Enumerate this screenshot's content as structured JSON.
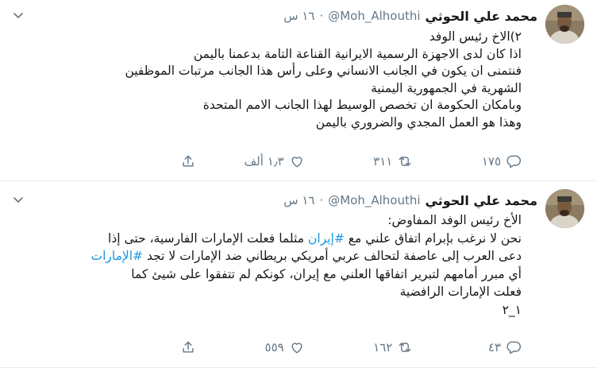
{
  "tweets": [
    {
      "name": "محمد علي الحوثي",
      "handle": "@Moh_Alhouthi",
      "separator": "·",
      "time": "١٦ س",
      "lines": [
        "٢)الاخ رئيس الوفد",
        "اذا كان لدى الاجهزة الرسمية الايرانية القناعة التامة بدعمنا باليمن",
        "فنتمنى ان يكون في الجانب الانساني وعلى رأس هذا الجانب مرتبات الموظفين",
        "الشهرية في الجمهورية اليمنية",
        "وبامكان الحكومة ان تخصص الوسيط لهذا الجانب الامم المتحدة",
        "وهذا هو العمل المجدي والضروري باليمن"
      ],
      "replies": "١٧٥",
      "retweets": "٣١١",
      "likes": "١٫٣ ألف"
    },
    {
      "name": "محمد علي الحوثي",
      "handle": "@Moh_Alhouthi",
      "separator": "·",
      "time": "١٦ س",
      "line1": "الأخ رئيس الوفد المفاوض:",
      "line2_a": "نحن لا نرغب بإبرام اتفاق علني مع ",
      "hashtag_iran": "#إيران",
      "line2_b": " مثلما فعلت الإمارات الفارسية، حتى إذا",
      "line3_a": "دعى العرب إلى عاصفة لتحالف عربي أمريكي بريطاني ضد الإمارات لا تجد ",
      "hashtag_emirates": "#الإمارات",
      "line4": "أي مبرر أمامهم لتبرير اتفاقها العلني مع إيران، كونكم لم تتفقوا على شيئ كما",
      "line5": "فعلت الإمارات الرافضية",
      "line6": "١_٢",
      "replies": "٤٣",
      "retweets": "١٦٢",
      "likes": "٥٥٩"
    }
  ],
  "colors": {
    "hashtag": "#1b95e0",
    "meta": "#657786",
    "divider": "#e6ecf0"
  }
}
